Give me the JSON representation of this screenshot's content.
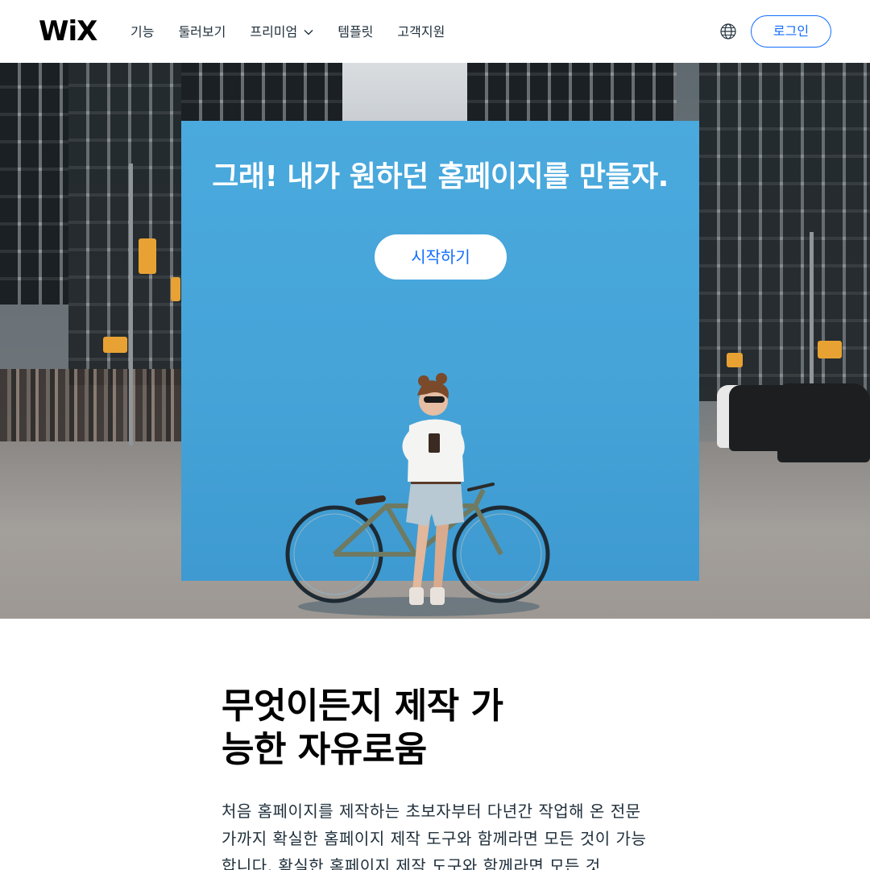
{
  "header": {
    "logo": "WiX",
    "nav": [
      {
        "label": "기능"
      },
      {
        "label": "둘러보기"
      },
      {
        "label": "프리미엄",
        "has_dropdown": true
      },
      {
        "label": "템플릿"
      },
      {
        "label": "고객지원"
      }
    ],
    "globe_icon": "globe-icon",
    "login_label": "로그인"
  },
  "hero": {
    "title": "그래! 내가 원하던 홈페이지를 만들자.",
    "cta_label": "시작하기",
    "wall_color": "#45a3d8"
  },
  "feature": {
    "title_line1": "무엇이든지 제작 가",
    "title_line2": "능한 자유로움",
    "body": "처음 홈페이지를 제작하는 초보자부터 다년간 작업해 온 전문가까지 확실한 홈페이지 제작 도구와 함께라면 모든 것이 가능합니다. 확실한 홈페이지 제작 도구와 함께라면 모든 것"
  },
  "colors": {
    "accent": "#116dff",
    "text": "#20303c",
    "background": "#ffffff"
  }
}
